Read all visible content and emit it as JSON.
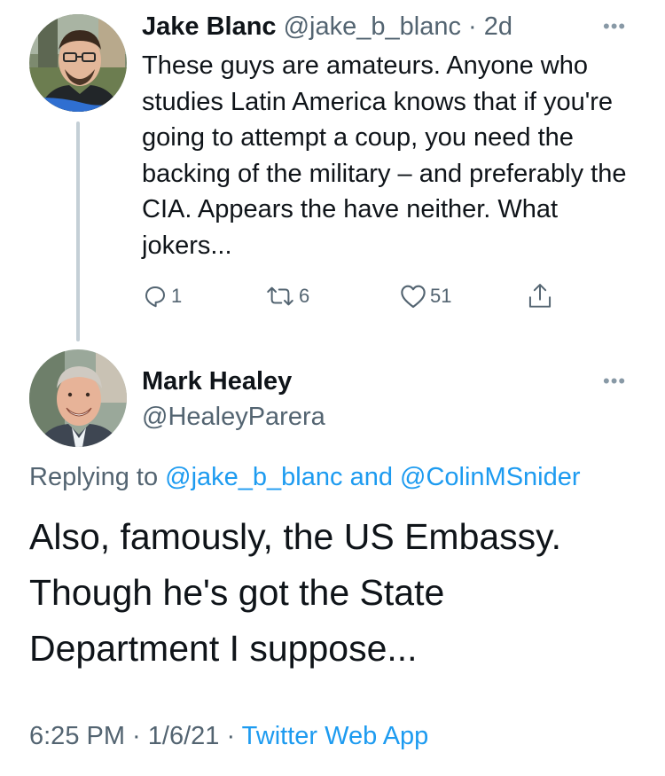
{
  "parent_tweet": {
    "author_name": "Jake Blanc",
    "handle": "@jake_b_blanc",
    "separator": " · ",
    "time": "2d",
    "more_label": "•••",
    "text": "These guys are amateurs. Anyone who studies Latin America knows that if you're going to attempt a coup, you need the backing of the military – and preferably the CIA. Appears the have neither. What jokers...",
    "actions": {
      "reply_icon": "reply-icon",
      "reply_count": "1",
      "retweet_icon": "retweet-icon",
      "retweet_count": "6",
      "like_icon": "heart-icon",
      "like_count": "51",
      "share_icon": "share-icon"
    }
  },
  "reply_tweet": {
    "author_name": "Mark Healey",
    "handle": "@HealeyParera",
    "more_label": "•••",
    "replying_prefix": "Replying to ",
    "replying_user1": "@jake_b_blanc",
    "replying_and": " and ",
    "replying_user2": "@ColinMSnider",
    "text": "Also, famously, the US Embassy. Though he's got the State Department I suppose...",
    "time": "6:25 PM",
    "meta_sep1": " · ",
    "date": "1/6/21",
    "meta_sep2": " · ",
    "source": "Twitter Web App"
  },
  "colors": {
    "link": "#1d9bf0",
    "muted": "#536471",
    "text": "#0f1419",
    "thread_line": "#c4cfd6"
  }
}
